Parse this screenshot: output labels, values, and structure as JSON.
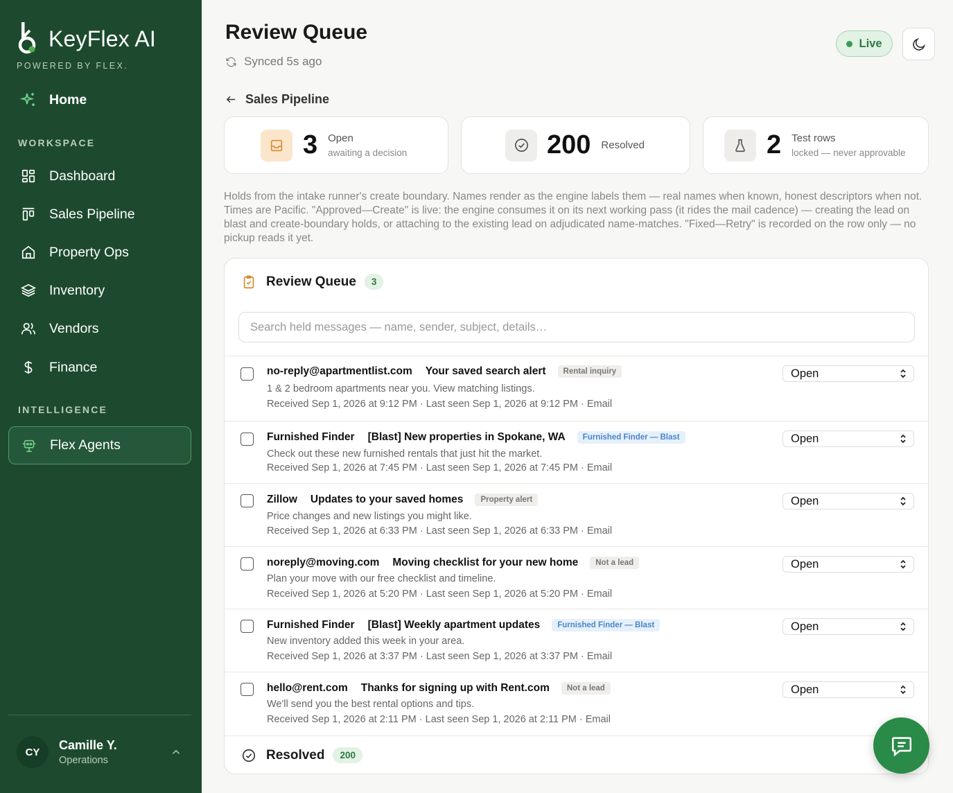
{
  "brand": {
    "name": "KeyFlex AI",
    "tagline": "POWERED BY FLEX."
  },
  "sidebar": {
    "home_label": "Home",
    "workspace_label": "WORKSPACE",
    "intelligence_label": "INTELLIGENCE",
    "workspace_items": [
      {
        "label": "Dashboard",
        "icon": "dashboard-icon"
      },
      {
        "label": "Sales Pipeline",
        "icon": "pipeline-icon"
      },
      {
        "label": "Property Ops",
        "icon": "home-icon"
      },
      {
        "label": "Inventory",
        "icon": "layers-icon"
      },
      {
        "label": "Vendors",
        "icon": "users-icon"
      },
      {
        "label": "Finance",
        "icon": "dollar-icon"
      }
    ],
    "intelligence_items": [
      {
        "label": "Flex Agents",
        "icon": "bot-icon",
        "active": true
      }
    ],
    "user": {
      "initials": "CY",
      "name": "Camille Y.",
      "role": "Operations"
    }
  },
  "header": {
    "title": "Review Queue",
    "synced": "Synced 5s ago",
    "live_label": "Live",
    "back_label": "Sales Pipeline"
  },
  "stats": [
    {
      "value": "3",
      "label": "Open",
      "sub": "awaiting a decision",
      "icon": "inbox-icon"
    },
    {
      "value": "200",
      "label": "Resolved",
      "sub": "",
      "icon": "check-circle-icon"
    },
    {
      "value": "2",
      "label": "Test rows",
      "sub": "locked — never approvable",
      "icon": "flask-icon"
    }
  ],
  "description": "Holds from the intake runner's create boundary. Names render as the engine labels them — real names when known, honest descriptors when not. Times are Pacific. \"Approved—Create\" is live: the engine consumes it on its next working pass (it rides the mail cadence) — creating the lead on blast and create-boundary holds, or attaching to the existing lead on adjudicated name-matches. \"Fixed—Retry\" is recorded on the row only — no pickup reads it yet.",
  "queue": {
    "title": "Review Queue",
    "count": "3",
    "search_placeholder": "Search held messages — name, sender, subject, details…",
    "rows": [
      {
        "sender": "no-reply@apartmentlist.com",
        "subject": "Your saved search alert",
        "tag": "Rental inquiry",
        "tag_style": "gray",
        "snippet": "1 & 2 bedroom apartments near you. View matching listings.",
        "meta": "Received Sep 1, 2026 at 9:12 PM · Last seen Sep 1, 2026 at 9:12 PM · Email",
        "status": "Open"
      },
      {
        "sender": "Furnished Finder",
        "subject": "[Blast] New properties in Spokane, WA",
        "tag": "Furnished Finder — Blast",
        "tag_style": "blue",
        "snippet": "Check out these new furnished rentals that just hit the market.",
        "meta": "Received Sep 1, 2026 at 7:45 PM · Last seen Sep 1, 2026 at 7:45 PM · Email",
        "status": "Open"
      },
      {
        "sender": "Zillow",
        "subject": "Updates to your saved homes",
        "tag": "Property alert",
        "tag_style": "gray",
        "snippet": "Price changes and new listings you might like.",
        "meta": "Received Sep 1, 2026 at 6:33 PM · Last seen Sep 1, 2026 at 6:33 PM · Email",
        "status": "Open"
      },
      {
        "sender": "noreply@moving.com",
        "subject": "Moving checklist for your new home",
        "tag": "Not a lead",
        "tag_style": "gray",
        "snippet": "Plan your move with our free checklist and timeline.",
        "meta": "Received Sep 1, 2026 at 5:20 PM · Last seen Sep 1, 2026 at 5:20 PM · Email",
        "status": "Open"
      },
      {
        "sender": "Furnished Finder",
        "subject": "[Blast] Weekly apartment updates",
        "tag": "Furnished Finder — Blast",
        "tag_style": "blue",
        "snippet": "New inventory added this week in your area.",
        "meta": "Received Sep 1, 2026 at 3:37 PM · Last seen Sep 1, 2026 at 3:37 PM · Email",
        "status": "Open"
      },
      {
        "sender": "hello@rent.com",
        "subject": "Thanks for signing up with Rent.com",
        "tag": "Not a lead",
        "tag_style": "gray",
        "snippet": "We'll send you the best rental options and tips.",
        "meta": "Received Sep 1, 2026 at 2:11 PM · Last seen Sep 1, 2026 at 2:11 PM · Email",
        "status": "Open"
      }
    ]
  },
  "resolved": {
    "title": "Resolved",
    "count": "200"
  },
  "colors": {
    "sidebar_bg": "#1d4a2e",
    "accent": "#2a8a48",
    "live": "#3a9a55"
  }
}
